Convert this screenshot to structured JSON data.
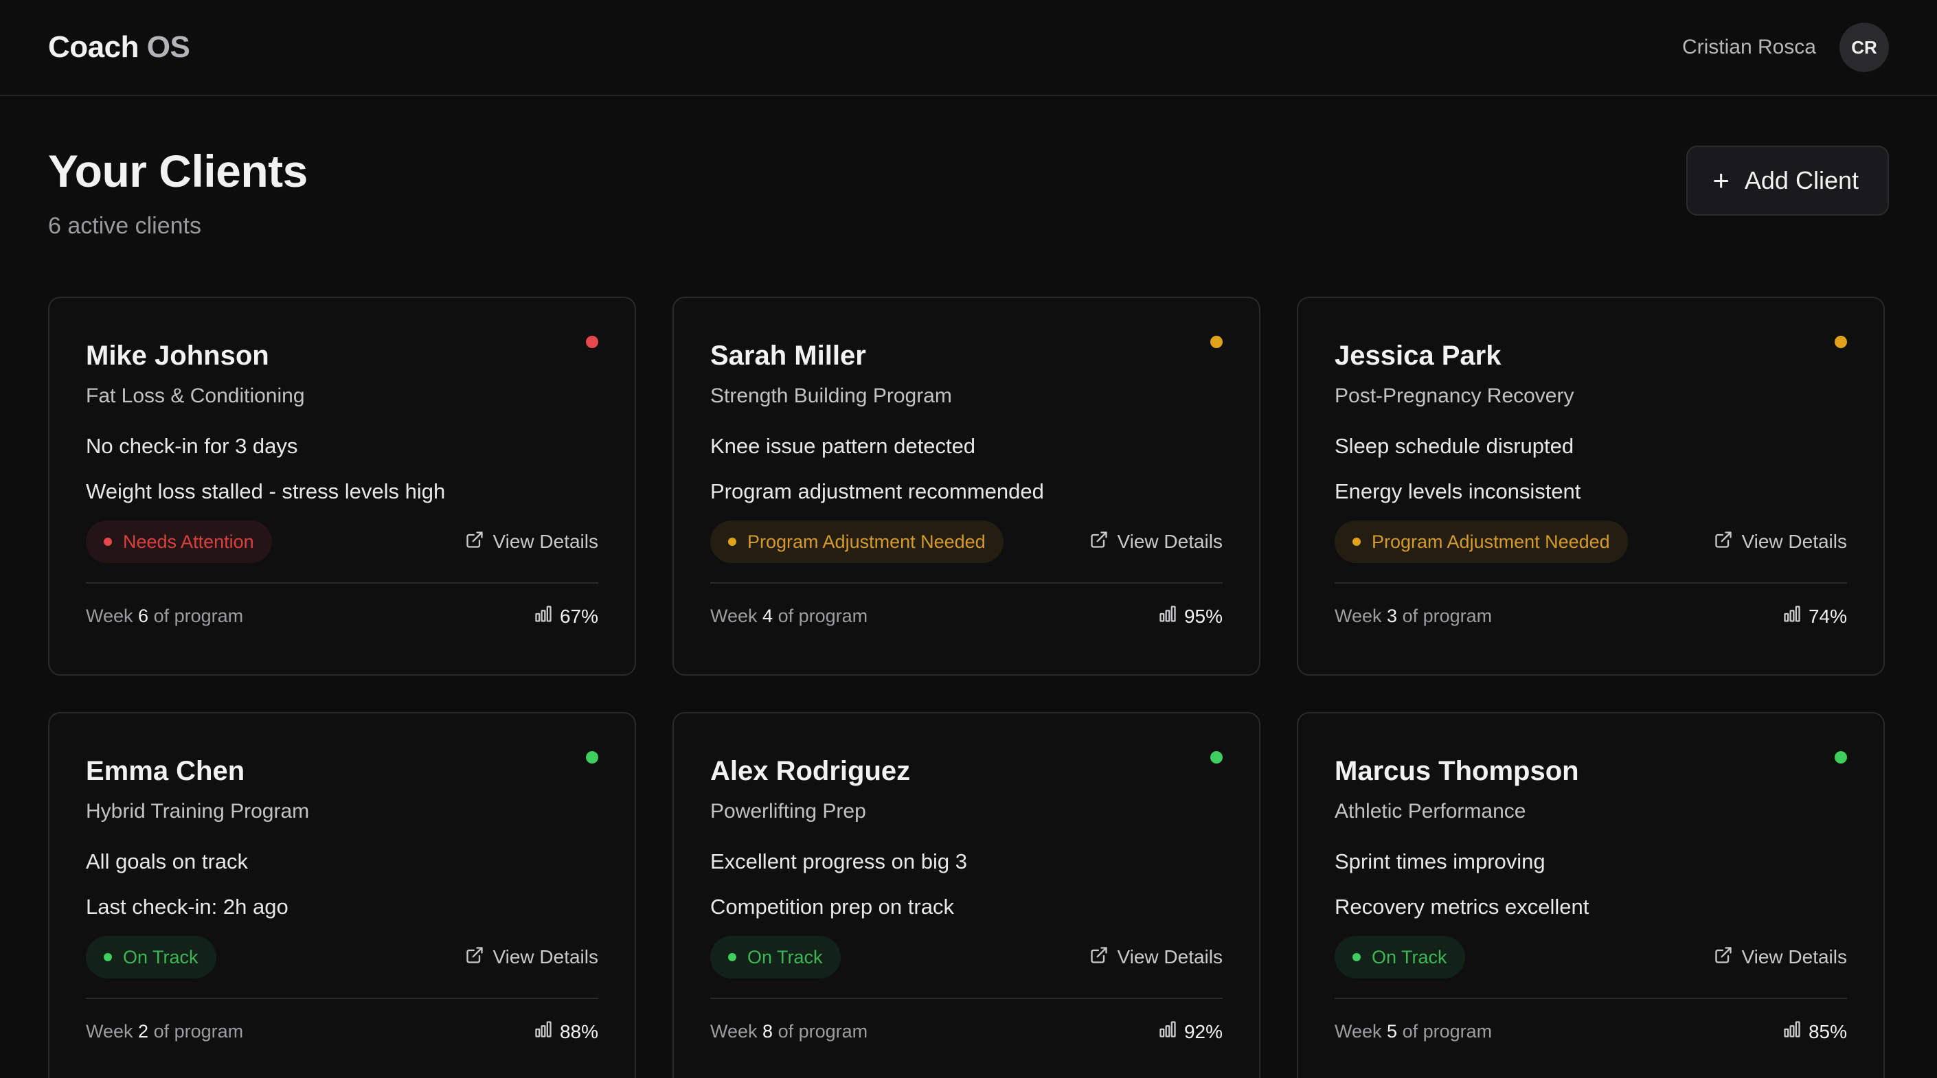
{
  "app": {
    "brand_main": "Coach",
    "brand_os": "OS"
  },
  "user": {
    "name": "Cristian Rosca",
    "initials": "CR"
  },
  "header": {
    "title": "Your Clients",
    "subtitle": "6 active clients",
    "add_label": "Add Client"
  },
  "colors": {
    "red": "#e5484d",
    "amber": "#e0a11b",
    "green": "#3ecf5e"
  },
  "clients": [
    {
      "name": "Mike Johnson",
      "program": "Fat Loss & Conditioning",
      "note1": "No check-in for 3 days",
      "note2": "Weight loss stalled - stress levels high",
      "status": "Needs Attention",
      "status_color": "red",
      "week_prefix": "Week",
      "week": "6",
      "week_suffix": "of program",
      "progress": "67%",
      "view": "View Details"
    },
    {
      "name": "Sarah Miller",
      "program": "Strength Building Program",
      "note1": "Knee issue pattern detected",
      "note2": "Program adjustment recommended",
      "status": "Program Adjustment Needed",
      "status_color": "amber",
      "week_prefix": "Week",
      "week": "4",
      "week_suffix": "of program",
      "progress": "95%",
      "view": "View Details"
    },
    {
      "name": "Jessica Park",
      "program": "Post-Pregnancy Recovery",
      "note1": "Sleep schedule disrupted",
      "note2": "Energy levels inconsistent",
      "status": "Program Adjustment Needed",
      "status_color": "amber",
      "week_prefix": "Week",
      "week": "3",
      "week_suffix": "of program",
      "progress": "74%",
      "view": "View Details"
    },
    {
      "name": "Emma Chen",
      "program": "Hybrid Training Program",
      "note1": "All goals on track",
      "note2": "Last check-in: 2h ago",
      "status": "On Track",
      "status_color": "green",
      "week_prefix": "Week",
      "week": "2",
      "week_suffix": "of program",
      "progress": "88%",
      "view": "View Details"
    },
    {
      "name": "Alex Rodriguez",
      "program": "Powerlifting Prep",
      "note1": "Excellent progress on big 3",
      "note2": "Competition prep on track",
      "status": "On Track",
      "status_color": "green",
      "week_prefix": "Week",
      "week": "8",
      "week_suffix": "of program",
      "progress": "92%",
      "view": "View Details"
    },
    {
      "name": "Marcus Thompson",
      "program": "Athletic Performance",
      "note1": "Sprint times improving",
      "note2": "Recovery metrics excellent",
      "status": "On Track",
      "status_color": "green",
      "week_prefix": "Week",
      "week": "5",
      "week_suffix": "of program",
      "progress": "85%",
      "view": "View Details"
    }
  ]
}
